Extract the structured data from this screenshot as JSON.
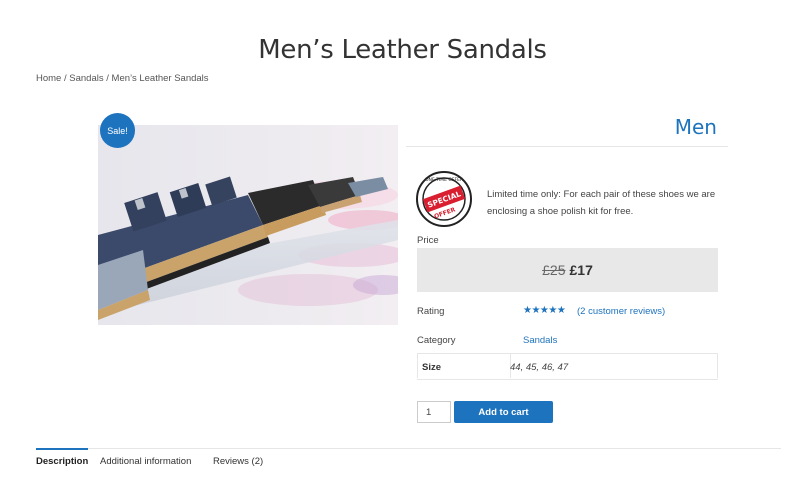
{
  "page": {
    "title": "Men’s Leather Sandals"
  },
  "breadcrumb": {
    "home": "Home",
    "sep1": " / ",
    "category": "Sandals",
    "sep2": " / ",
    "current": "Men’s Leather Sandals"
  },
  "product": {
    "sale_badge": "Sale!",
    "category_title": "Men",
    "offer_badge_text": [
      "ONE TIME OFFER",
      "SPECIAL OFFER"
    ],
    "offer_text": "Limited time only: For each pair of these shoes we are enclosing a shoe polish kit for free.",
    "price_label": "Price",
    "old_price": "£25",
    "new_price": "£17",
    "rating_label": "Rating",
    "rating_stars": "★★★★★",
    "rating_value": 5,
    "reviews_link": "(2 customer reviews)",
    "category_label": "Category",
    "category_value": "Sandals",
    "size_label": "Size",
    "size_values": "44, 45, 46, 47",
    "quantity": "1",
    "add_to_cart": "Add to cart"
  },
  "tabs": [
    {
      "label": "Description",
      "active": true
    },
    {
      "label": "Additional information",
      "active": false
    },
    {
      "label": "Reviews (2)",
      "active": false
    }
  ],
  "colors": {
    "accent": "#1e73be",
    "price_box": "#e8e8e8"
  }
}
